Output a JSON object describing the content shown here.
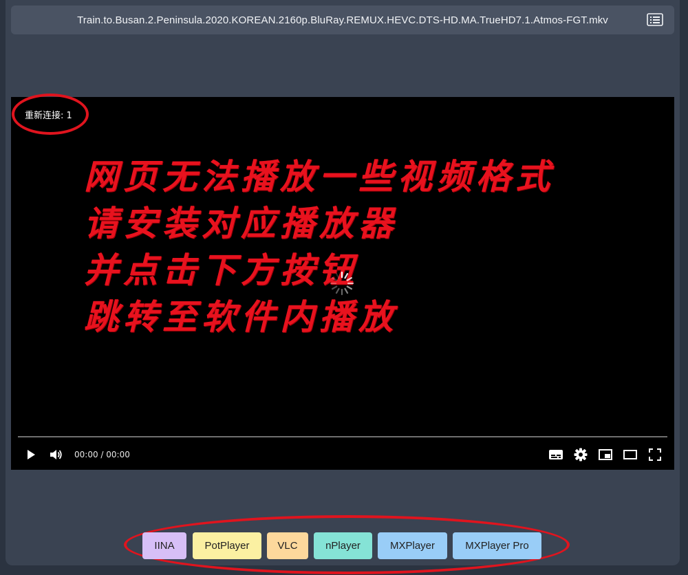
{
  "header": {
    "title": "Train.to.Busan.2.Peninsula.2020.KOREAN.2160p.BluRay.REMUX.HEVC.DTS-HD.MA.TrueHD7.1.Atmos-FGT.mkv",
    "menu_icon": "list-icon"
  },
  "player": {
    "reconnect_text": "重新连接: 1",
    "overlay_lines": [
      "网页无法播放一些视频格式",
      "请安装对应播放器",
      "并点击下方按钮",
      "跳转至软件内播放"
    ],
    "overlay_color": "#e8121e",
    "progress": 0,
    "time_display": "00:00 / 00:00",
    "controls": [
      "play-icon",
      "volume-icon",
      "subtitles-icon",
      "settings-icon",
      "picture-in-picture-icon",
      "theater-mode-icon",
      "fullscreen-icon"
    ]
  },
  "external_players": [
    {
      "label": "IINA",
      "color": "#d7bff7"
    },
    {
      "label": "PotPlayer",
      "color": "#fbf0a2"
    },
    {
      "label": "VLC",
      "color": "#fdd89c"
    },
    {
      "label": "nPlayer",
      "color": "#85e3d6"
    },
    {
      "label": "MXPlayer",
      "color": "#99cdf7"
    },
    {
      "label": "MXPlayer Pro",
      "color": "#99cdf7"
    }
  ],
  "annotation_color": "#e0141e"
}
